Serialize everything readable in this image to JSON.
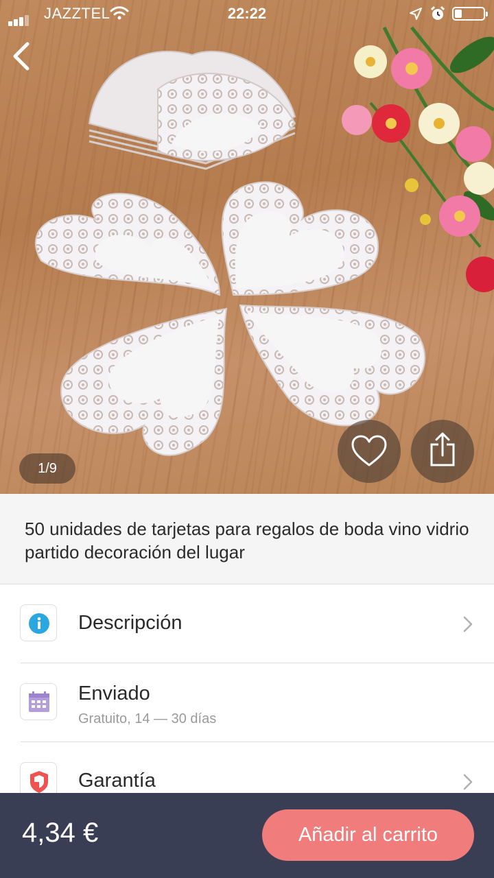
{
  "status_bar": {
    "carrier": "JAZZTEL",
    "time": "22:22"
  },
  "product": {
    "image_counter": "1/9",
    "title": "50 unidades de tarjetas para regalos de boda vino vidrio partido decoración del lugar",
    "price": "4,34 €"
  },
  "icons": {
    "back": "chevron-left-icon",
    "favorite": "heart-outline-icon",
    "share": "share-icon",
    "description": "info-icon",
    "shipping": "calendar-icon",
    "warranty": "shield-icon",
    "row_chevron": "chevron-right-icon"
  },
  "rows": {
    "description": {
      "label": "Descripción"
    },
    "shipping": {
      "label": "Enviado",
      "detail": "Gratuito, 14 — 30 días"
    },
    "warranty": {
      "label": "Garantía"
    }
  },
  "actions": {
    "add_to_cart": "Añadir al carrito"
  },
  "colors": {
    "accent": "#f07c7c",
    "bottom_bar": "#3a3e55",
    "info_icon": "#2aa7de",
    "calendar_icon": "#b39ddb",
    "shield_icon": "#ef5350"
  }
}
